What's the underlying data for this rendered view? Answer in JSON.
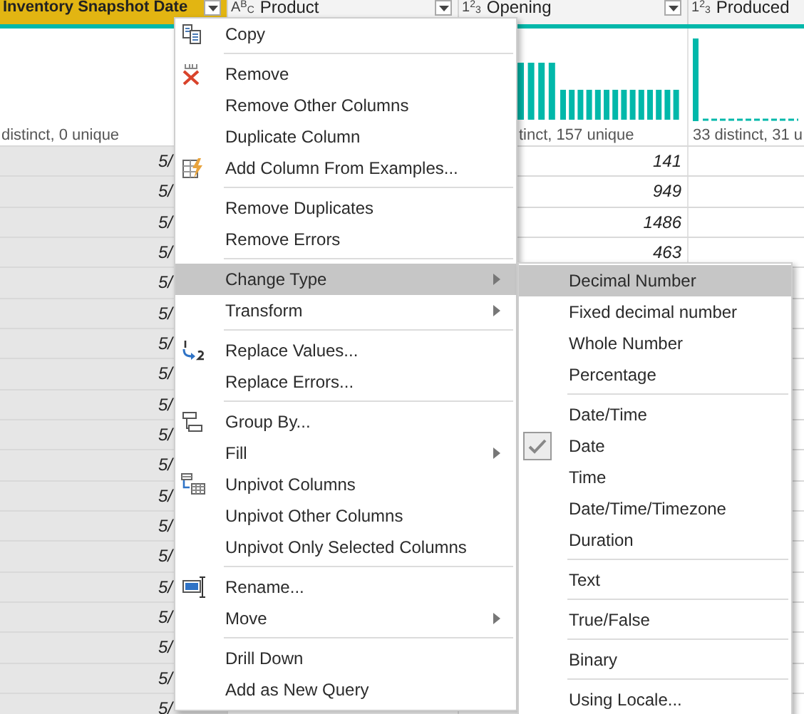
{
  "table": {
    "columns": [
      {
        "name": "Inventory Snapshot Date",
        "selected": true,
        "stats": "distinct, 0 unique",
        "values": [
          "5/",
          "5/",
          "5/",
          "5/",
          "5/",
          "5/",
          "5/",
          "5/",
          "5/",
          "5/",
          "5/",
          "5/",
          "5/",
          "5/",
          "5/",
          "5/",
          "5/",
          "5/",
          "5/"
        ]
      },
      {
        "name": "Product",
        "type_label": "A$^{B}$$_{C}$",
        "selected": false
      },
      {
        "name": "Opening",
        "type_label": "1$^{2}$$_{3}$",
        "selected": false,
        "has_distribution": true,
        "stats": "tinct, 157 unique",
        "values": [
          "141",
          "949",
          "1486",
          "463"
        ]
      },
      {
        "name": "Produced",
        "type_label": "1$^{2}$$_{3}$",
        "selected": false,
        "has_distribution": true,
        "stats": "33 distinct, 31 u"
      }
    ]
  },
  "context_menu": {
    "groups": [
      {
        "items": [
          {
            "label": "Copy",
            "selected": false,
            "submenu": false
          }
        ]
      },
      {
        "items": [
          {
            "label": "Remove",
            "selected": false,
            "submenu": false
          },
          {
            "label": "Remove Other Columns",
            "selected": false,
            "submenu": false
          },
          {
            "label": "Duplicate Column",
            "selected": false,
            "submenu": false
          },
          {
            "label": "Add Column From Examples...",
            "selected": false,
            "submenu": false
          }
        ]
      },
      {
        "items": [
          {
            "label": "Remove Duplicates",
            "selected": false,
            "submenu": false
          },
          {
            "label": "Remove Errors",
            "selected": false,
            "submenu": false
          }
        ]
      },
      {
        "items": [
          {
            "label": "Change Type",
            "selected": true,
            "submenu": true
          },
          {
            "label": "Transform",
            "selected": false,
            "submenu": true
          }
        ]
      },
      {
        "items": [
          {
            "label": "Replace Values...",
            "selected": false,
            "submenu": false
          },
          {
            "label": "Replace Errors...",
            "selected": false,
            "submenu": false
          }
        ]
      },
      {
        "items": [
          {
            "label": "Group By...",
            "selected": false,
            "submenu": false
          },
          {
            "label": "Fill",
            "selected": false,
            "submenu": true
          },
          {
            "label": "Unpivot Columns",
            "selected": false,
            "submenu": false
          },
          {
            "label": "Unpivot Other Columns",
            "selected": false,
            "submenu": false
          },
          {
            "label": "Unpivot Only Selected Columns",
            "selected": false,
            "submenu": false
          }
        ]
      },
      {
        "items": [
          {
            "label": "Rename...",
            "selected": false,
            "submenu": false
          },
          {
            "label": "Move",
            "selected": false,
            "submenu": true
          }
        ]
      },
      {
        "items": [
          {
            "label": "Drill Down",
            "selected": false,
            "submenu": false
          },
          {
            "label": "Add as New Query",
            "selected": false,
            "submenu": false
          }
        ]
      }
    ]
  },
  "type_menu": {
    "groups": [
      {
        "items": [
          {
            "label": "Decimal Number",
            "selected": true,
            "checked": false
          },
          {
            "label": "Fixed decimal number",
            "selected": false,
            "checked": false
          },
          {
            "label": "Whole Number",
            "selected": false,
            "checked": false
          },
          {
            "label": "Percentage",
            "selected": false,
            "checked": false
          }
        ]
      },
      {
        "items": [
          {
            "label": "Date/Time",
            "selected": false,
            "checked": false
          },
          {
            "label": "Date",
            "selected": false,
            "checked": true
          },
          {
            "label": "Time",
            "selected": false,
            "checked": false
          },
          {
            "label": "Date/Time/Timezone",
            "selected": false,
            "checked": false
          },
          {
            "label": "Duration",
            "selected": false,
            "checked": false
          }
        ]
      },
      {
        "items": [
          {
            "label": "Text",
            "selected": false,
            "checked": false
          }
        ]
      },
      {
        "items": [
          {
            "label": "True/False",
            "selected": false,
            "checked": false
          }
        ]
      },
      {
        "items": [
          {
            "label": "Binary",
            "selected": false,
            "checked": false
          }
        ]
      },
      {
        "items": [
          {
            "label": "Using Locale...",
            "selected": false,
            "checked": false
          }
        ]
      }
    ]
  }
}
